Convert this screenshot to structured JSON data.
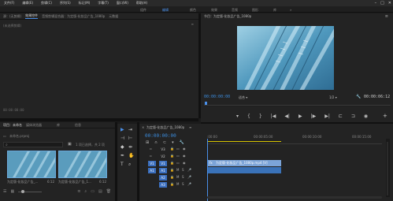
{
  "menubar": {
    "items": [
      "文件(F)",
      "编辑(E)",
      "剪辑(C)",
      "序列(S)",
      "标记(M)",
      "字幕(T)",
      "窗口(W)",
      "帮助(H)"
    ]
  },
  "workspace": {
    "tabs": [
      "组件",
      "编辑",
      "颜色",
      "效果",
      "音频",
      "图形",
      "库"
    ],
    "active_index": 1,
    "overflow": "»"
  },
  "source_panel": {
    "tabs": [
      "源：(无剪辑)",
      "效果控件",
      "音频剪辑混合器：为定版-化妆品广告_1080p",
      "元数据"
    ],
    "active_index": 1,
    "no_clip_text": "(未选择剪辑)",
    "timecode": "00:00:00:00"
  },
  "program_monitor": {
    "title": "节目：为定版-化妆品广告_1080p",
    "timecode_current": "00:00:00:00",
    "fit": "适合",
    "ratio": "1/2",
    "timecode_total": "00:00:06:12",
    "controls": [
      "marker-icon",
      "in-icon",
      "out-icon",
      "go-in-icon",
      "step-back-icon",
      "play-icon",
      "step-forward-icon",
      "go-out-icon",
      "lift-icon",
      "extract-icon",
      "export-frame-icon"
    ],
    "add_symbol": "+"
  },
  "project_panel": {
    "tabs": [
      "项目：未命名",
      "媒体浏览器",
      "库",
      "信息"
    ],
    "active_index": 0,
    "path": "未命名.prproj",
    "search_placeholder": "",
    "count_text": "1 项已选择，共 2 项",
    "items": [
      {
        "label": "为定版-化妆品广告_...",
        "duration": "6:12"
      },
      {
        "label": "为定版-化妆品广告_1...",
        "duration": "6:12"
      }
    ]
  },
  "timeline": {
    "title": "为定版-化妆品广告_1080p",
    "timecode": "00:00:00:00",
    "ruler_labels": [
      ":00:00",
      "00:00:05:00",
      "00:00:10:00",
      "00:00:15:00"
    ],
    "video_tracks": [
      "V3",
      "V2",
      "V1"
    ],
    "audio_tracks": [
      "A1",
      "A2",
      "A3"
    ],
    "clip_label": "为定版-化妆品广告_1080p.mp4 [V]",
    "colors": {
      "accent": "#4a8fe8",
      "clip_video": "#7ca4d8",
      "clip_audio": "#3a72b8",
      "yellow": "#d6c300"
    }
  }
}
